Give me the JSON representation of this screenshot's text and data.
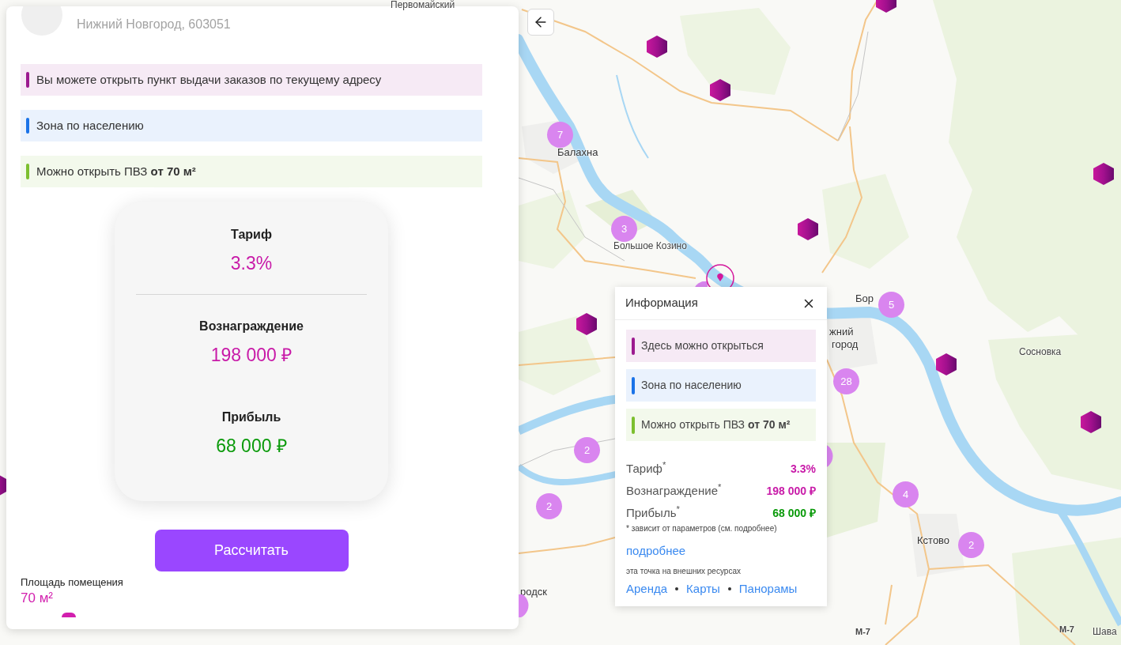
{
  "panel": {
    "address": "Нижний Новгород, 603051",
    "notices": [
      {
        "text": "Вы можете открыть пункт выдачи заказов по текущему адресу",
        "color": "#9c1a8f"
      },
      {
        "text": "Зона по населению",
        "color": "#1a73e8"
      },
      {
        "text": "Можно открыть ПВЗ **от 70 м²**",
        "color": "#7cbf2f"
      }
    ],
    "metric_groups": [
      {
        "metrics": [
          {
            "label": "Тариф",
            "value": "3.3%",
            "color": "#c81aa8"
          }
        ]
      },
      {
        "metrics": [
          {
            "label": "Вознаграждение",
            "value": "198 000 ₽",
            "color": "#c81aa8"
          },
          {
            "label": "Прибыль",
            "value": "68 000 ₽",
            "color": "#0a9a0a"
          }
        ]
      }
    ],
    "calculate_button": "Рассчитать",
    "area": {
      "label": "Площадь помещения",
      "value": "70 м²"
    }
  },
  "map": {
    "places": [
      {
        "text": "Первомайский",
        "kind": "village"
      },
      {
        "text": "Балахна",
        "kind": "town"
      },
      {
        "text": "Большое Козино",
        "kind": "village"
      },
      {
        "text": "Бор",
        "kind": "town"
      },
      {
        "text": "жний",
        "kind": "town"
      },
      {
        "text": "город",
        "kind": "town"
      },
      {
        "text": "Сосновка",
        "kind": "village"
      },
      {
        "text": "Кстово",
        "kind": "town"
      },
      {
        "text": "родск",
        "kind": "town"
      },
      {
        "text": "М-7",
        "kind": "road"
      },
      {
        "text": "М-7",
        "kind": "road"
      },
      {
        "text": "Шава",
        "kind": "village"
      }
    ],
    "markers": [
      {
        "kind": "hexagon"
      },
      {
        "kind": "hexagon"
      },
      {
        "kind": "hexagon"
      },
      {
        "kind": "cluster",
        "count": "7"
      },
      {
        "kind": "hexagon"
      },
      {
        "kind": "cluster",
        "count": "3"
      },
      {
        "kind": "hexagon"
      },
      {
        "kind": "cluster"
      },
      {
        "kind": "selected"
      },
      {
        "kind": "cluster",
        "count": "5"
      },
      {
        "kind": "hexagon"
      },
      {
        "kind": "hexagon"
      },
      {
        "kind": "cluster",
        "count": "28"
      },
      {
        "kind": "hexagon"
      },
      {
        "kind": "cluster",
        "count": "2"
      },
      {
        "kind": "cluster"
      },
      {
        "kind": "hexagon"
      },
      {
        "kind": "cluster",
        "count": "4"
      },
      {
        "kind": "cluster",
        "count": "2"
      },
      {
        "kind": "cluster",
        "count": "2"
      },
      {
        "kind": "cluster"
      }
    ]
  },
  "info_popup": {
    "title": "Информация",
    "notices": [
      {
        "text": "Здесь можно открыться",
        "color": "#9c1a8f"
      },
      {
        "text": "Зона по населению",
        "color": "#1a73e8"
      },
      {
        "text": "Можно открыть ПВЗ **от 70 м²**",
        "color": "#7cbf2f"
      }
    ],
    "metrics": [
      {
        "label": "Тариф$^{*}$",
        "value": "3.3%",
        "color": "#c81aa8"
      },
      {
        "label": "Вознаграждение$^{*}$",
        "value": "198 000 ₽",
        "color": "#c81aa8"
      },
      {
        "label": "Прибыль$^{*}$",
        "value": "68 000 ₽",
        "color": "#0a9a0a"
      }
    ],
    "note": "* зависит от параметров (см. подробнее)",
    "more_link": "подробнее",
    "external_caption": "эта точка на внешних ресурсах",
    "external_links": [
      "Аренда",
      "Карты",
      "Панорамы"
    ]
  }
}
